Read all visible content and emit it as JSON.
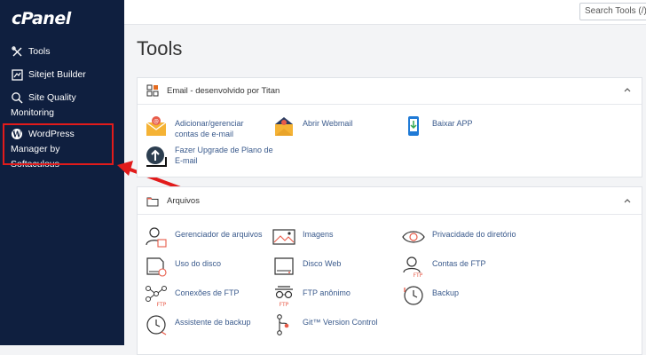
{
  "brand": {
    "logo": "cPanel"
  },
  "sidebar": {
    "items": [
      {
        "label": "Tools",
        "icon": "tools-icon"
      },
      {
        "label": "Sitejet Builder",
        "icon": "sitejet-icon"
      },
      {
        "label": "Site Quality Monitoring",
        "icon": "site-quality-icon"
      },
      {
        "label": "WordPress Manager by Softaculous",
        "icon": "wordpress-icon"
      }
    ]
  },
  "search": {
    "placeholder": "Search Tools (/)"
  },
  "page": {
    "title": "Tools"
  },
  "panels": [
    {
      "title": "Email - desenvolvido por Titan",
      "icon": "email-grid-icon",
      "tools": [
        {
          "label": "Adicionar/gerenciar contas de e-mail",
          "icon": "email-accounts-icon"
        },
        {
          "label": "Abrir Webmail",
          "icon": "webmail-icon"
        },
        {
          "label": "Baixar APP",
          "icon": "mobile-app-icon"
        },
        {
          "label": "Fazer Upgrade de Plano de E-mail",
          "icon": "upgrade-icon"
        }
      ]
    },
    {
      "title": "Arquivos",
      "icon": "folder-icon",
      "tools": [
        {
          "label": "Gerenciador de arquivos",
          "icon": "file-manager-icon"
        },
        {
          "label": "Imagens",
          "icon": "images-icon"
        },
        {
          "label": "Privacidade do diretório",
          "icon": "directory-privacy-icon"
        },
        {
          "label": "Uso do disco",
          "icon": "disk-usage-icon"
        },
        {
          "label": "Disco Web",
          "icon": "web-disk-icon"
        },
        {
          "label": "Contas de FTP",
          "icon": "ftp-accounts-icon"
        },
        {
          "label": "Conexões de FTP",
          "icon": "ftp-connections-icon"
        },
        {
          "label": "FTP anônimo",
          "icon": "anonymous-ftp-icon"
        },
        {
          "label": "Backup",
          "icon": "backup-icon"
        },
        {
          "label": "Assistente de backup",
          "icon": "backup-wizard-icon"
        },
        {
          "label": "Git™ Version Control",
          "icon": "git-icon"
        }
      ]
    }
  ],
  "colors": {
    "sidebar_bg": "#0f1f3f",
    "highlight": "#e21b1b",
    "link": "#3a5a8c"
  }
}
